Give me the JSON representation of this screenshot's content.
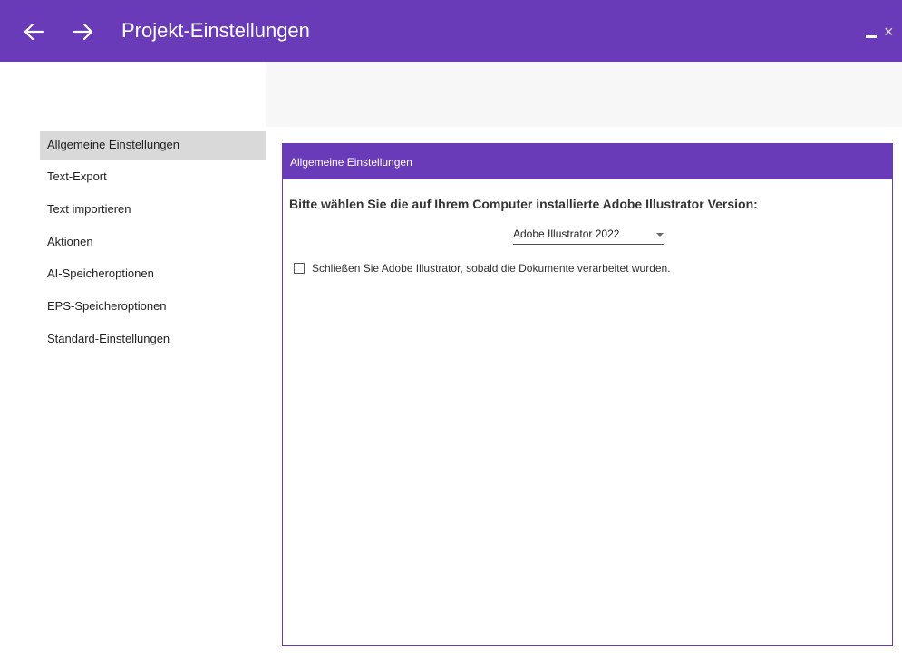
{
  "window": {
    "title": "Projekt-Einstellungen",
    "accent_color": "#6a3bb8",
    "back_icon": "arrow-left-icon",
    "forward_icon": "arrow-right-icon",
    "minimize_icon": "minimize-icon",
    "close_icon": "close-icon",
    "close_glyph": "×"
  },
  "sidebar": {
    "items": [
      {
        "label": "Allgemeine Einstellungen",
        "selected": true
      },
      {
        "label": "Text-Export"
      },
      {
        "label": "Text importieren"
      },
      {
        "label": "Aktionen"
      },
      {
        "label": "AI-Speicheroptionen"
      },
      {
        "label": "EPS-Speicheroptionen"
      },
      {
        "label": "Standard-Einstellungen"
      }
    ]
  },
  "panel": {
    "header": "Allgemeine Einstellungen",
    "question": "Bitte wählen Sie die auf Ihrem Computer installierte Adobe Illustrator Version:",
    "version_select": {
      "value": "Adobe Illustrator 2022"
    },
    "close_ai_checkbox": {
      "label": "Schließen Sie Adobe Illustrator, sobald die Dokumente verarbeitet wurden.",
      "checked": false
    }
  }
}
